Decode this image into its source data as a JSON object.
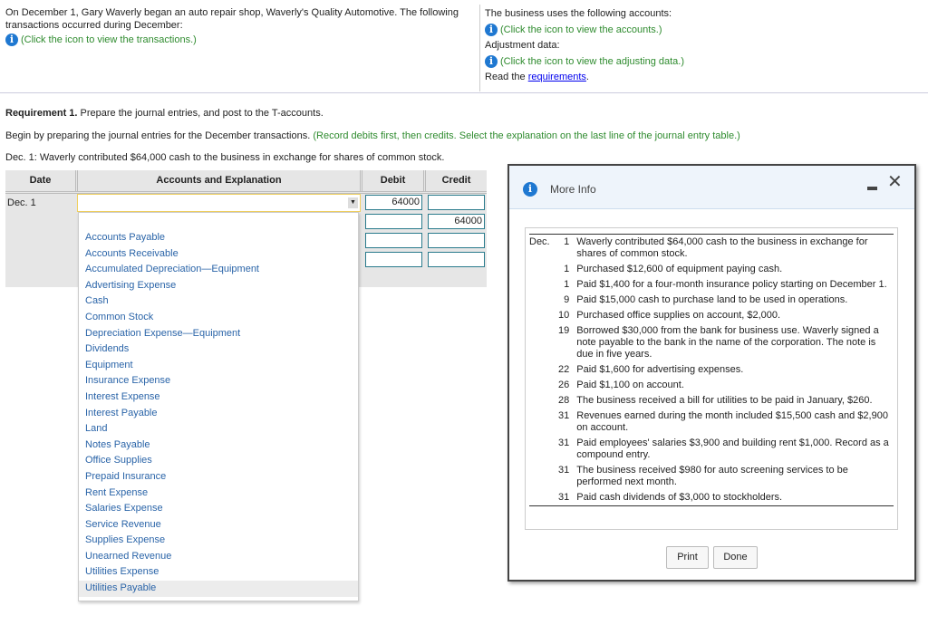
{
  "intro": {
    "text": "On December 1, Gary Waverly began an auto repair shop, Waverly's Quality Automotive. The following transactions occurred during December:",
    "link": "(Click the icon to view the transactions.)"
  },
  "side": {
    "accounts_text": "The business uses the following accounts:",
    "accounts_link": "(Click the icon to view the accounts.)",
    "adjust_text": "Adjustment data:",
    "adjust_link": "(Click the icon to view the adjusting data.)",
    "read_prefix": "Read the ",
    "read_link": "requirements",
    "read_suffix": "."
  },
  "requirement": {
    "label": "Requirement 1.",
    "text": " Prepare the journal entries, and post to the T-accounts."
  },
  "instruction": {
    "text": "Begin by preparing the journal entries for the December transactions. ",
    "note": "(Record debits first, then credits. Select the explanation on the last line of the journal entry table.)"
  },
  "task": "Dec. 1: Waverly contributed $64,000 cash to the business in exchange for shares of common stock.",
  "table": {
    "headers": [
      "Date",
      "Accounts and Explanation",
      "Debit",
      "Credit"
    ],
    "date": "Dec. 1",
    "debit": [
      "64000",
      "",
      "",
      ""
    ],
    "credit": [
      "",
      "64000",
      "",
      ""
    ]
  },
  "dropdown": {
    "selected": "",
    "items": [
      "Accounts Payable",
      "Accounts Receivable",
      "Accumulated Depreciation—Equipment",
      "Advertising Expense",
      "Cash",
      "Common Stock",
      "Depreciation Expense—Equipment",
      "Dividends",
      "Equipment",
      "Insurance Expense",
      "Interest Expense",
      "Interest Payable",
      "Land",
      "Notes Payable",
      "Office Supplies",
      "Prepaid Insurance",
      "Rent Expense",
      "Salaries Expense",
      "Service Revenue",
      "Supplies Expense",
      "Unearned Revenue",
      "Utilities Expense",
      "Utilities Payable"
    ],
    "highlighted": "Utilities Payable"
  },
  "modal": {
    "title": "More Info",
    "month": "Dec.",
    "print": "Print",
    "done": "Done",
    "transactions": [
      {
        "day": "1",
        "text": "Waverly contributed $64,000 cash to the business in exchange for shares of common stock."
      },
      {
        "day": "1",
        "text": "Purchased $12,600 of equipment paying cash."
      },
      {
        "day": "1",
        "text": "Paid $1,400 for a four-month insurance policy starting on December 1."
      },
      {
        "day": "9",
        "text": "Paid $15,000 cash to purchase land to be used in operations."
      },
      {
        "day": "10",
        "text": "Purchased office supplies on account, $2,000."
      },
      {
        "day": "19",
        "text": "Borrowed $30,000 from the bank for business use. Waverly signed a note payable to the bank in the name of the corporation. The note is due in five years."
      },
      {
        "day": "22",
        "text": "Paid $1,600 for advertising expenses."
      },
      {
        "day": "26",
        "text": "Paid $1,100 on account."
      },
      {
        "day": "28",
        "text": "The business received a bill for utilities to be paid in January, $260."
      },
      {
        "day": "31",
        "text": "Revenues earned during the month included $15,500 cash and $2,900 on account."
      },
      {
        "day": "31",
        "text": "Paid employees' salaries $3,900 and building rent $1,000. Record as a compound entry."
      },
      {
        "day": "31",
        "text": "The business received $980 for auto screening services to be performed next month."
      },
      {
        "day": "31",
        "text": "Paid cash dividends of $3,000 to stockholders."
      }
    ]
  }
}
